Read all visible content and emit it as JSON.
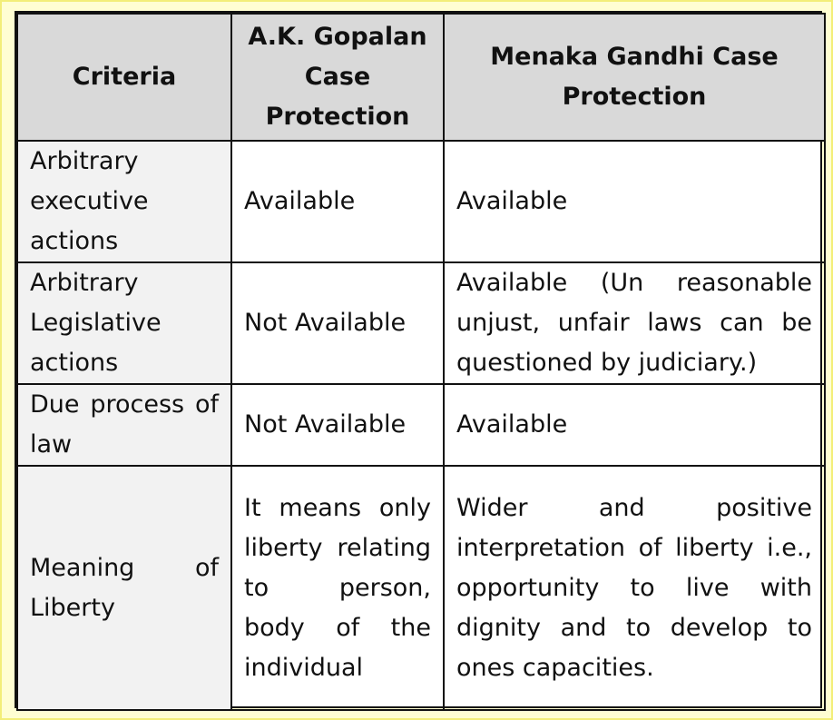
{
  "table": {
    "headers": [
      "Criteria",
      "A.K. Gopalan Case Protection",
      "Menaka Gandhi Case Protection"
    ],
    "rows": [
      {
        "criteria": "Arbitrary executive actions",
        "gopalan": "Available",
        "menaka": "Available"
      },
      {
        "criteria": "Arbitrary Legislative actions",
        "gopalan": "Not Available",
        "menaka": "Available (Un reasonable unjust, unfair laws can be questioned by judiciary.)"
      },
      {
        "criteria": "Due process of law",
        "gopalan": "Not Available",
        "menaka": "Available"
      },
      {
        "criteria": "Meaning of Liberty",
        "gopalan": "It means only liberty relating to person, body of the individual",
        "menaka": "Wider and positive interpretation of liberty i.e., opportunity to live with dignity and to develop to ones capacities."
      }
    ]
  }
}
